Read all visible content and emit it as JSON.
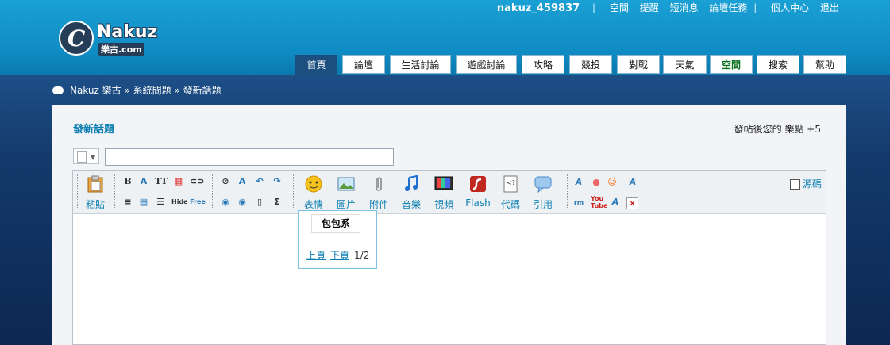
{
  "header": {
    "user": "nakuz_459837",
    "links": [
      "空間",
      "提醒",
      "短消息",
      "論壇任務"
    ],
    "links2": [
      "個人中心",
      "退出"
    ],
    "logo_name": "Nakuz",
    "logo_sub": "樂古.com"
  },
  "nav": {
    "tabs": [
      {
        "label": "首頁"
      },
      {
        "label": "論壇"
      },
      {
        "label": "生活討論"
      },
      {
        "label": "遊戲討論"
      },
      {
        "label": "攻略"
      },
      {
        "label": "競投"
      },
      {
        "label": "對戰"
      },
      {
        "label": "天氣"
      },
      {
        "label": "空間"
      },
      {
        "label": "搜索"
      },
      {
        "label": "幫助"
      }
    ]
  },
  "breadcrumb": "Nakuz 樂古 » 系統問題 » 發新話題",
  "panel": {
    "title": "發新話題",
    "points": "發帖後您的 樂點 +5"
  },
  "toolbar": {
    "paste": "粘貼",
    "emoticon": "表情",
    "image": "圖片",
    "attachment": "附件",
    "music": "音樂",
    "video": "視頻",
    "flash": "Flash",
    "code": "代碼",
    "quote": "引用",
    "source": "源碼"
  },
  "popup": {
    "title": "包包系",
    "prev": "上頁",
    "next": "下頁",
    "page": "1/2"
  },
  "colors": {
    "accent": "#0d7fb2",
    "header": "#1aa0d4",
    "band": "#143a6b"
  }
}
